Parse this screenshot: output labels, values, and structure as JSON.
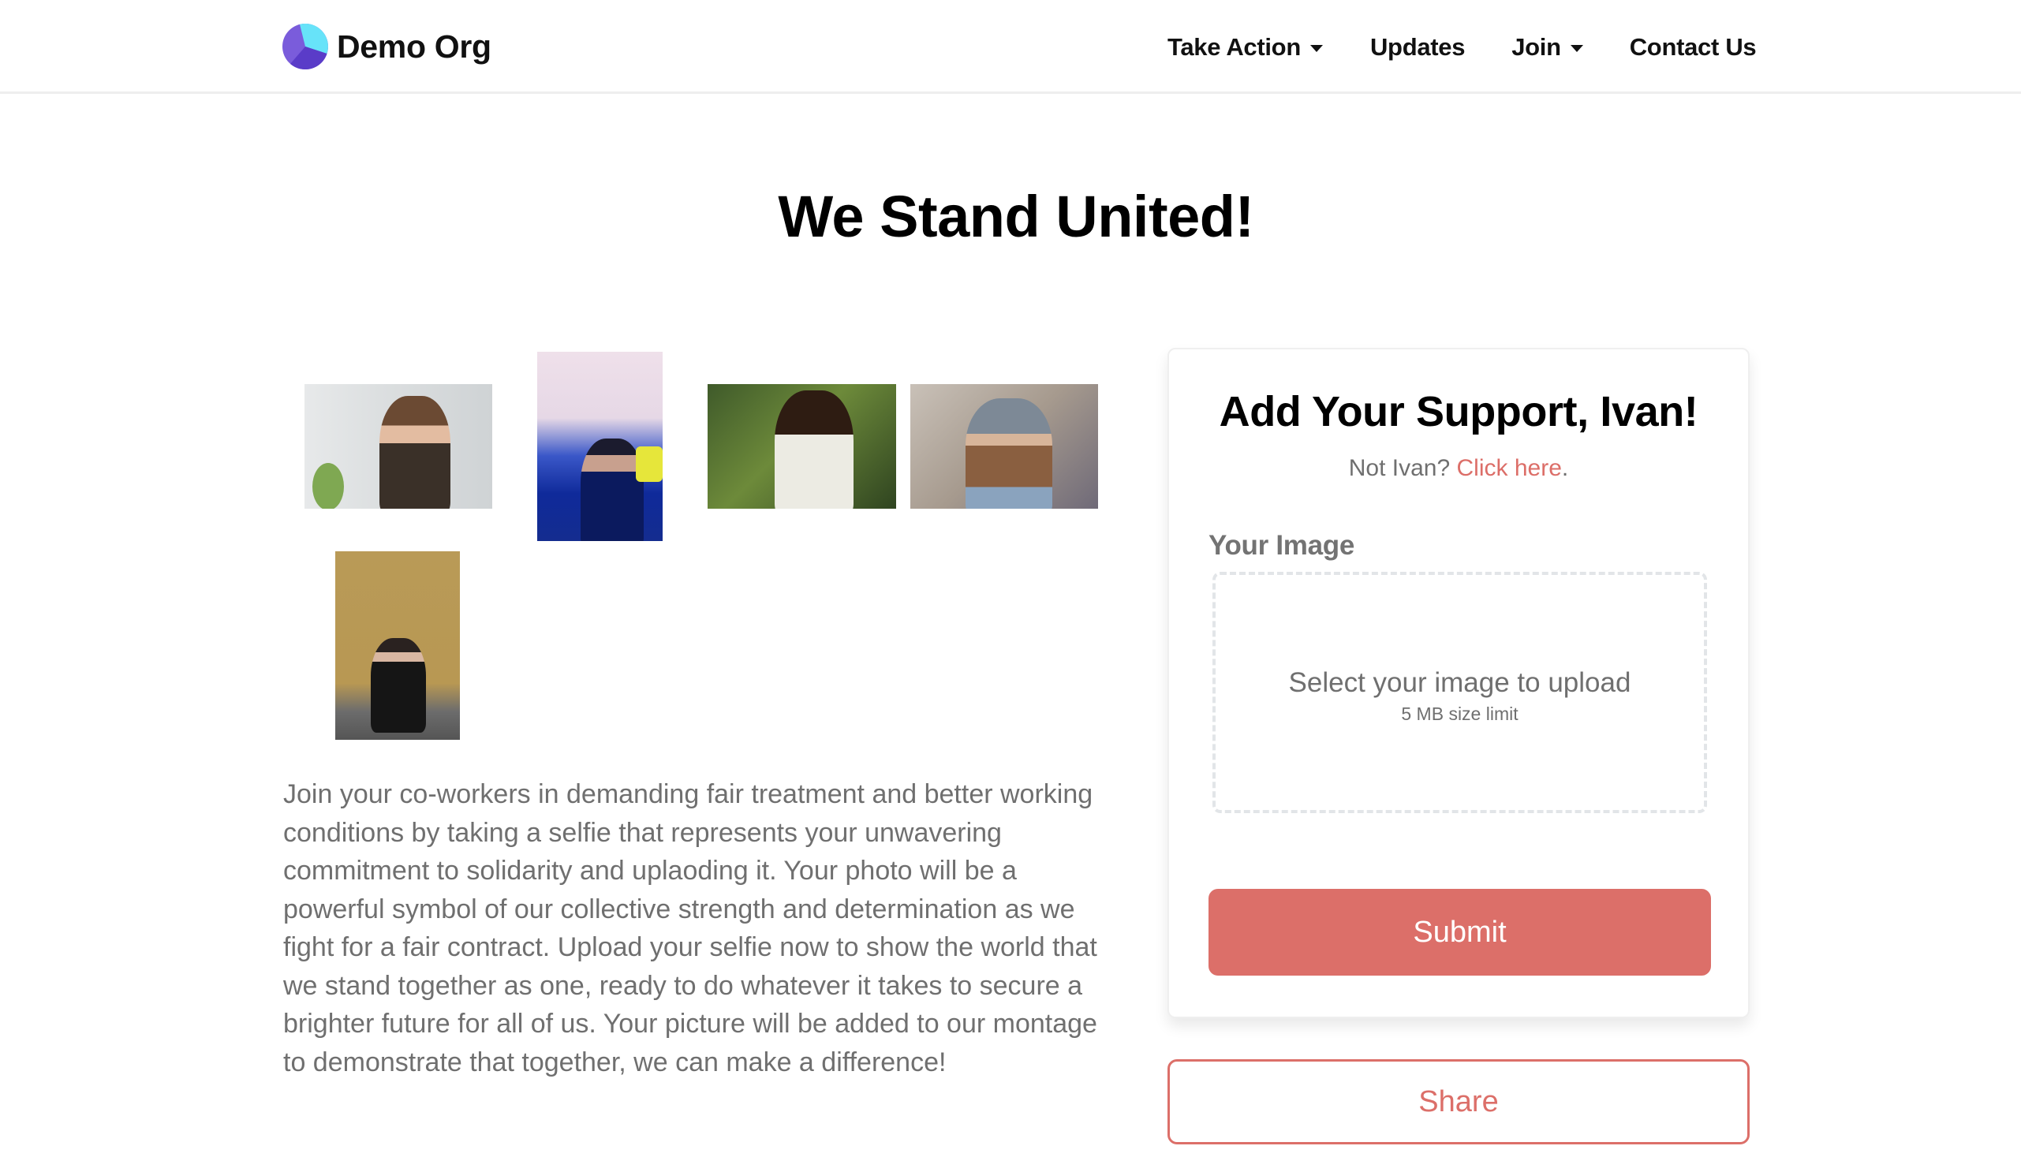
{
  "header": {
    "brand": {
      "name": "Demo Org",
      "logo_icon": "pie-logo-icon",
      "logo_colors": [
        "#7a5cdb",
        "#67e3f9",
        "#5a3cc8"
      ]
    },
    "nav": [
      {
        "label": "Take Action",
        "has_dropdown": true
      },
      {
        "label": "Updates",
        "has_dropdown": false
      },
      {
        "label": "Join",
        "has_dropdown": true
      },
      {
        "label": "Contact Us",
        "has_dropdown": false
      }
    ]
  },
  "main": {
    "title": "We Stand United!",
    "gallery": [
      {
        "alt": "Woman with curly hair taking a selfie"
      },
      {
        "alt": "Person in blue jacket taking a mirror selfie"
      },
      {
        "alt": "Man with backpack taking a selfie outdoors"
      },
      {
        "alt": "Woman in headscarf taking a selfie"
      },
      {
        "alt": "Woman in black crouching against a yellow wall"
      }
    ],
    "description": "Join your co-workers in demanding fair treatment and better working conditions by taking a selfie that represents your unwavering commitment to solidarity and uplaoding it. Your photo will be a powerful symbol of our collective strength and determination as we fight for a fair contract. Upload your selfie now to show the world that we stand together as one, ready to do whatever it takes to secure a brighter future for all of us. Your picture will be added to our montage to demonstrate that together, we can make a difference!"
  },
  "form": {
    "title": "Add Your Support, Ivan!",
    "not_user_prefix": "Not Ivan? ",
    "not_user_link": "Click here",
    "not_user_suffix": ".",
    "image_label": "Your Image",
    "dropzone_text": "Select your image to upload",
    "dropzone_hint": "5 MB size limit",
    "submit_label": "Submit",
    "share_label": "Share"
  },
  "colors": {
    "accent": "#dc6f69",
    "text_muted": "#6f6f6f",
    "divider": "#eeeeee"
  }
}
